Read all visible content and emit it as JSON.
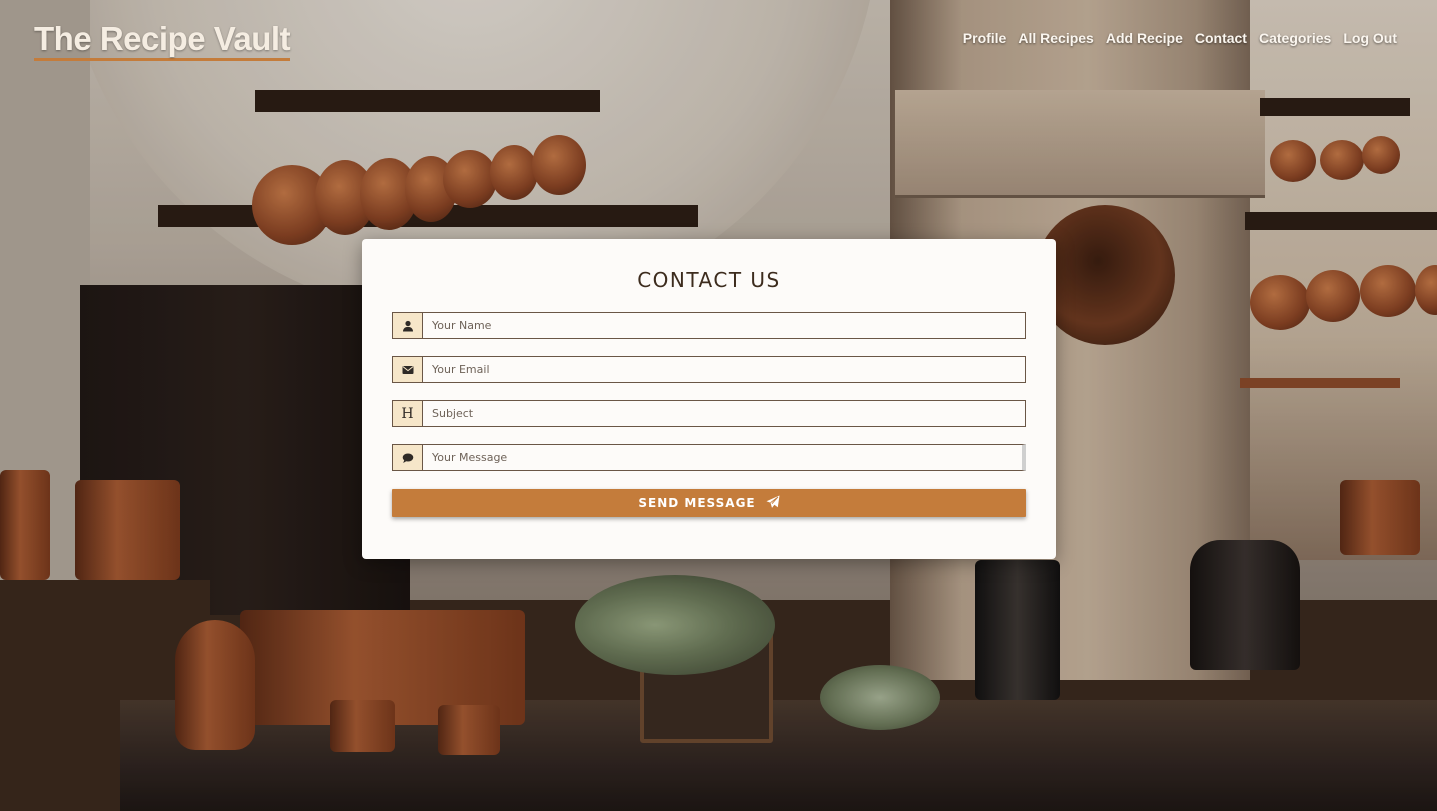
{
  "brand": {
    "title": "The Recipe Vault"
  },
  "nav": {
    "items": [
      "Profile",
      "All Recipes",
      "Add Recipe",
      "Contact",
      "Categories",
      "Log Out"
    ]
  },
  "contact": {
    "heading": "CONTACT US",
    "fields": {
      "name": {
        "placeholder": "Your Name",
        "icon": "user-icon"
      },
      "email": {
        "placeholder": "Your Email",
        "icon": "envelope-icon"
      },
      "subject": {
        "placeholder": "Subject",
        "icon": "heading-icon",
        "icon_glyph": "H"
      },
      "message": {
        "placeholder": "Your Message",
        "icon": "comment-icon"
      }
    },
    "submit": {
      "label": "SEND MESSAGE",
      "icon": "paper-plane-icon"
    }
  },
  "colors": {
    "accent": "#c47c3b",
    "icon_bg": "#f6e6c9",
    "card_bg": "#fdfbf9",
    "heading_text": "#3d2c1e"
  }
}
